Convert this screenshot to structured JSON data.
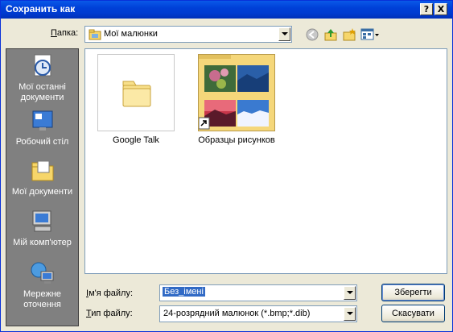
{
  "window": {
    "title": "Сохранить как",
    "help_label": "?",
    "close_label": "X"
  },
  "lookin": {
    "label_prefix": "П",
    "label_rest": "апка:",
    "value": "Мої малюнки"
  },
  "toolbar": {
    "icons": [
      "back-icon",
      "up-folder-icon",
      "new-folder-icon",
      "view-menu-icon"
    ]
  },
  "places": [
    {
      "label": "Мої останні документи",
      "icon": "recent-documents-icon"
    },
    {
      "label": "Робочий стіл",
      "icon": "desktop-icon"
    },
    {
      "label": "Мої документи",
      "icon": "my-documents-icon"
    },
    {
      "label": "Мій комп'ютер",
      "icon": "my-computer-icon"
    },
    {
      "label": "Мережне оточення",
      "icon": "network-icon"
    }
  ],
  "files": [
    {
      "name": "Google Talk",
      "icon": "folder-icon"
    },
    {
      "name": "Образцы рисунков",
      "icon": "image-folder-thumbnail"
    }
  ],
  "filename": {
    "label_prefix": "І",
    "label_rest": "м'я файлу:",
    "value": "Без_імені"
  },
  "filetype": {
    "label_prefix": "Т",
    "label_rest": "ип файлу:",
    "value": "24-розрядний малюнок (*.bmp;*.dib)"
  },
  "buttons": {
    "save": "Зберегти",
    "cancel": "Скасувати"
  }
}
